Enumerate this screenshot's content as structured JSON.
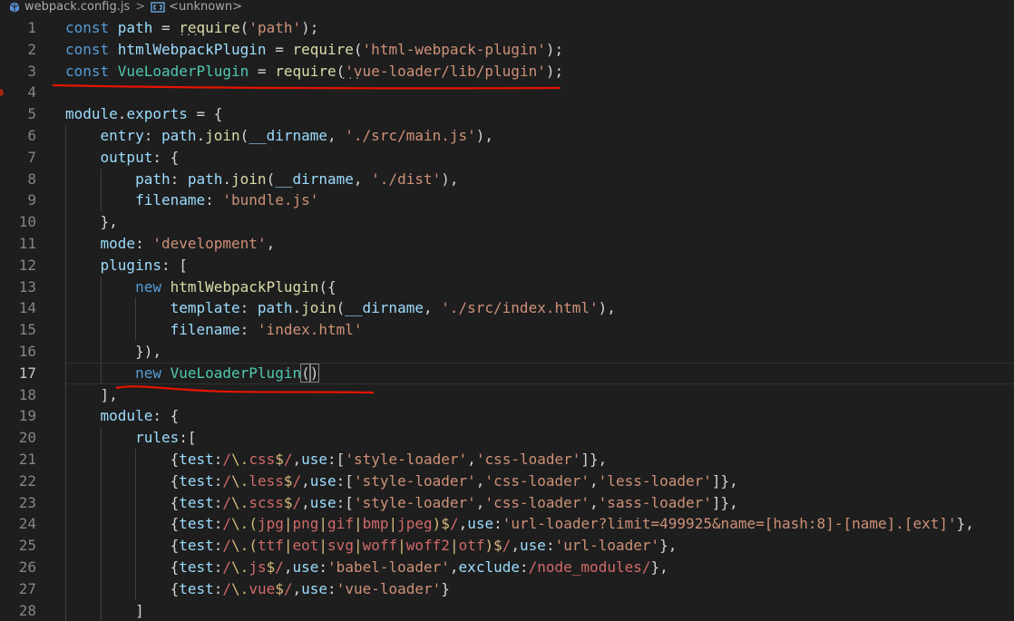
{
  "breadcrumb": {
    "file": "webpack.config.js",
    "separator": ">",
    "symbol": "<unknown>",
    "file_icon": "js-file-icon",
    "symbol_icon": "symbol-field-icon"
  },
  "colors": {
    "background": "#1e1e1e",
    "keyword": "#569cd6",
    "variable": "#9cdcfe",
    "class": "#4ec9b0",
    "function": "#dcdcaa",
    "string": "#ce9178",
    "regex": "#d16969",
    "annotation": "#e51400"
  },
  "editor": {
    "current_line": 17,
    "line_numbers": [
      "1",
      "2",
      "3",
      "4",
      "5",
      "6",
      "7",
      "8",
      "9",
      "10",
      "11",
      "12",
      "13",
      "14",
      "15",
      "16",
      "17",
      "18",
      "19",
      "20",
      "21",
      "22",
      "23",
      "24",
      "25",
      "26",
      "27",
      "28"
    ],
    "lines": [
      [
        [
          "const ",
          "k"
        ],
        [
          "path",
          "v"
        ],
        [
          " = ",
          "p"
        ],
        [
          "require",
          "f"
        ],
        [
          "(",
          "p"
        ],
        [
          "'path'",
          "s"
        ],
        [
          ");",
          "p"
        ]
      ],
      [
        [
          "const ",
          "k"
        ],
        [
          "htmlWebpackPlugin",
          "v"
        ],
        [
          " = ",
          "p"
        ],
        [
          "require",
          "f"
        ],
        [
          "(",
          "p"
        ],
        [
          "'html-webpack-plugin'",
          "s"
        ],
        [
          ");",
          "p"
        ]
      ],
      [
        [
          "const ",
          "k"
        ],
        [
          "VueLoaderPlugin",
          "c"
        ],
        [
          " = ",
          "p"
        ],
        [
          "require",
          "f"
        ],
        [
          "(",
          "p"
        ],
        [
          "'vue-loader/lib/plugin'",
          "s"
        ],
        [
          ");",
          "p"
        ]
      ],
      [],
      [
        [
          "module",
          "v"
        ],
        [
          ".",
          "p"
        ],
        [
          "exports",
          "v"
        ],
        [
          " = {",
          "p"
        ]
      ],
      [
        [
          "    entry",
          "v"
        ],
        [
          ": ",
          "p"
        ],
        [
          "path",
          "v"
        ],
        [
          ".",
          "p"
        ],
        [
          "join",
          "f"
        ],
        [
          "(",
          "p"
        ],
        [
          "__dirname",
          "v"
        ],
        [
          ", ",
          "p"
        ],
        [
          "'./src/main.js'",
          "s"
        ],
        [
          "),",
          "p"
        ]
      ],
      [
        [
          "    output",
          "v"
        ],
        [
          ": {",
          "p"
        ]
      ],
      [
        [
          "        path",
          "v"
        ],
        [
          ": ",
          "p"
        ],
        [
          "path",
          "v"
        ],
        [
          ".",
          "p"
        ],
        [
          "join",
          "f"
        ],
        [
          "(",
          "p"
        ],
        [
          "__dirname",
          "v"
        ],
        [
          ", ",
          "p"
        ],
        [
          "'./dist'",
          "s"
        ],
        [
          "),",
          "p"
        ]
      ],
      [
        [
          "        filename",
          "v"
        ],
        [
          ": ",
          "p"
        ],
        [
          "'bundle.js'",
          "s"
        ]
      ],
      [
        [
          "    },",
          "p"
        ]
      ],
      [
        [
          "    mode",
          "v"
        ],
        [
          ": ",
          "p"
        ],
        [
          "'development'",
          "s"
        ],
        [
          ",",
          "p"
        ]
      ],
      [
        [
          "    plugins",
          "v"
        ],
        [
          ": [",
          "p"
        ]
      ],
      [
        [
          "        new ",
          "k"
        ],
        [
          "htmlWebpackPlugin",
          "f"
        ],
        [
          "({",
          "p"
        ]
      ],
      [
        [
          "            template",
          "v"
        ],
        [
          ": ",
          "p"
        ],
        [
          "path",
          "v"
        ],
        [
          ".",
          "p"
        ],
        [
          "join",
          "f"
        ],
        [
          "(",
          "p"
        ],
        [
          "__dirname",
          "v"
        ],
        [
          ", ",
          "p"
        ],
        [
          "'./src/index.html'",
          "s"
        ],
        [
          "),",
          "p"
        ]
      ],
      [
        [
          "            filename",
          "v"
        ],
        [
          ": ",
          "p"
        ],
        [
          "'index.html'",
          "s"
        ]
      ],
      [
        [
          "        }),",
          "p"
        ]
      ],
      [
        [
          "        new ",
          "k"
        ],
        [
          "VueLoaderPlugin",
          "c"
        ],
        [
          "(",
          "bp"
        ],
        [
          ")",
          "bp"
        ]
      ],
      [
        [
          "    ],",
          "p"
        ]
      ],
      [
        [
          "    module",
          "v"
        ],
        [
          ": {",
          "p"
        ]
      ],
      [
        [
          "        rules",
          "v"
        ],
        [
          ":[",
          "p"
        ]
      ],
      [
        [
          "            {",
          "p"
        ],
        [
          "test",
          "v"
        ],
        [
          ":",
          "p"
        ],
        [
          "/",
          "r"
        ],
        [
          "\\.",
          "re"
        ],
        [
          "css",
          "r"
        ],
        [
          "$",
          "re"
        ],
        [
          "/",
          "r"
        ],
        [
          ",",
          "p"
        ],
        [
          "use",
          "v"
        ],
        [
          ":[",
          "p"
        ],
        [
          "'style-loader'",
          "s"
        ],
        [
          ",",
          "p"
        ],
        [
          "'css-loader'",
          "s"
        ],
        [
          "]},",
          "p"
        ]
      ],
      [
        [
          "            {",
          "p"
        ],
        [
          "test",
          "v"
        ],
        [
          ":",
          "p"
        ],
        [
          "/",
          "r"
        ],
        [
          "\\.",
          "re"
        ],
        [
          "less",
          "r"
        ],
        [
          "$",
          "re"
        ],
        [
          "/",
          "r"
        ],
        [
          ",",
          "p"
        ],
        [
          "use",
          "v"
        ],
        [
          ":[",
          "p"
        ],
        [
          "'style-loader'",
          "s"
        ],
        [
          ",",
          "p"
        ],
        [
          "'css-loader'",
          "s"
        ],
        [
          ",",
          "p"
        ],
        [
          "'less-loader'",
          "s"
        ],
        [
          "]},",
          "p"
        ]
      ],
      [
        [
          "            {",
          "p"
        ],
        [
          "test",
          "v"
        ],
        [
          ":",
          "p"
        ],
        [
          "/",
          "r"
        ],
        [
          "\\.",
          "re"
        ],
        [
          "scss",
          "r"
        ],
        [
          "$",
          "re"
        ],
        [
          "/",
          "r"
        ],
        [
          ",",
          "p"
        ],
        [
          "use",
          "v"
        ],
        [
          ":[",
          "p"
        ],
        [
          "'style-loader'",
          "s"
        ],
        [
          ",",
          "p"
        ],
        [
          "'css-loader'",
          "s"
        ],
        [
          ",",
          "p"
        ],
        [
          "'sass-loader'",
          "s"
        ],
        [
          "]},",
          "p"
        ]
      ],
      [
        [
          "            {",
          "p"
        ],
        [
          "test",
          "v"
        ],
        [
          ":",
          "p"
        ],
        [
          "/",
          "r"
        ],
        [
          "\\.",
          "re"
        ],
        [
          "(",
          "re"
        ],
        [
          "jpg",
          "r"
        ],
        [
          "|",
          "re"
        ],
        [
          "png",
          "r"
        ],
        [
          "|",
          "re"
        ],
        [
          "gif",
          "r"
        ],
        [
          "|",
          "re"
        ],
        [
          "bmp",
          "r"
        ],
        [
          "|",
          "re"
        ],
        [
          "jpeg",
          "r"
        ],
        [
          ")$",
          "re"
        ],
        [
          "/",
          "r"
        ],
        [
          ",",
          "p"
        ],
        [
          "use",
          "v"
        ],
        [
          ":",
          "p"
        ],
        [
          "'url-loader?limit=499925&name=[hash:8]-[name].[ext]'",
          "s"
        ],
        [
          "},",
          "p"
        ]
      ],
      [
        [
          "            {",
          "p"
        ],
        [
          "test",
          "v"
        ],
        [
          ":",
          "p"
        ],
        [
          "/",
          "r"
        ],
        [
          "\\.",
          "re"
        ],
        [
          "(",
          "re"
        ],
        [
          "ttf",
          "r"
        ],
        [
          "|",
          "re"
        ],
        [
          "eot",
          "r"
        ],
        [
          "|",
          "re"
        ],
        [
          "svg",
          "r"
        ],
        [
          "|",
          "re"
        ],
        [
          "woff",
          "r"
        ],
        [
          "|",
          "re"
        ],
        [
          "woff2",
          "r"
        ],
        [
          "|",
          "re"
        ],
        [
          "otf",
          "r"
        ],
        [
          ")$",
          "re"
        ],
        [
          "/",
          "r"
        ],
        [
          ",",
          "p"
        ],
        [
          "use",
          "v"
        ],
        [
          ":",
          "p"
        ],
        [
          "'url-loader'",
          "s"
        ],
        [
          "},",
          "p"
        ]
      ],
      [
        [
          "            {",
          "p"
        ],
        [
          "test",
          "v"
        ],
        [
          ":",
          "p"
        ],
        [
          "/",
          "r"
        ],
        [
          "\\.",
          "re"
        ],
        [
          "js",
          "r"
        ],
        [
          "$",
          "re"
        ],
        [
          "/",
          "r"
        ],
        [
          ",",
          "p"
        ],
        [
          "use",
          "v"
        ],
        [
          ":",
          "p"
        ],
        [
          "'babel-loader'",
          "s"
        ],
        [
          ",",
          "p"
        ],
        [
          "exclude",
          "v"
        ],
        [
          ":",
          "p"
        ],
        [
          "/node_modules/",
          "r"
        ],
        [
          "},",
          "p"
        ]
      ],
      [
        [
          "            {",
          "p"
        ],
        [
          "test",
          "v"
        ],
        [
          ":",
          "p"
        ],
        [
          "/",
          "r"
        ],
        [
          "\\.",
          "re"
        ],
        [
          "vue",
          "r"
        ],
        [
          "$",
          "re"
        ],
        [
          "/",
          "r"
        ],
        [
          ",",
          "p"
        ],
        [
          "use",
          "v"
        ],
        [
          ":",
          "p"
        ],
        [
          "'vue-loader'",
          "s"
        ],
        [
          "}",
          "p"
        ]
      ],
      [
        [
          "        ]",
          "p"
        ]
      ]
    ]
  }
}
